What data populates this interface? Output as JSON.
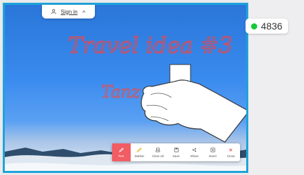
{
  "session": {
    "sign_in_label": "Sign in",
    "counter": "4836"
  },
  "canvas": {
    "heading": "Travel idea #3",
    "subtext": "Tanz"
  },
  "toolbar": {
    "items": [
      {
        "label": "Pen",
        "icon": "pen-icon"
      },
      {
        "label": "Marker",
        "icon": "marker-icon"
      },
      {
        "label": "Clear all",
        "icon": "clear-all-icon"
      },
      {
        "label": "Save",
        "icon": "save-icon"
      },
      {
        "label": "Share",
        "icon": "share-icon"
      },
      {
        "label": "Insert",
        "icon": "insert-icon"
      },
      {
        "label": "Close",
        "icon": "close-icon"
      }
    ]
  },
  "colors": {
    "accent": "#f25c63",
    "frame": "#1fa3d9",
    "status": "#18c838",
    "ink": "#e24a52"
  }
}
